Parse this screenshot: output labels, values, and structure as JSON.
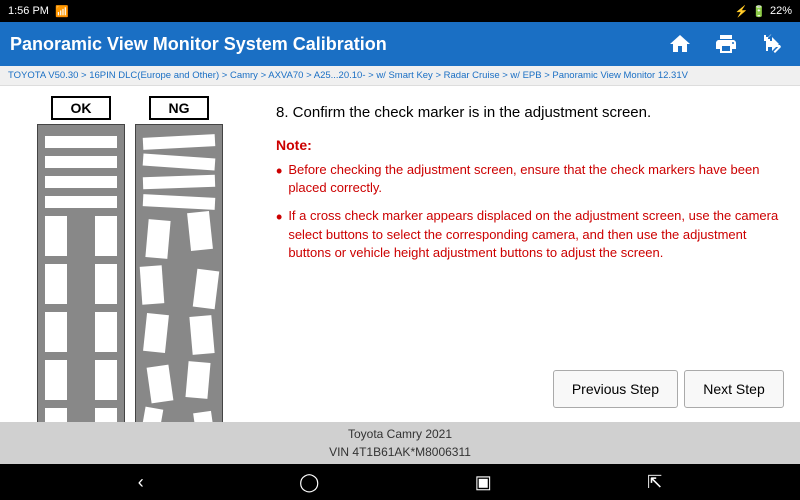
{
  "status_bar": {
    "time": "1:56 PM",
    "battery": "22%"
  },
  "header": {
    "title": "Panoramic View Monitor System Calibration",
    "home_icon": "🏠",
    "print_icon": "🖨",
    "share_icon": "⬆"
  },
  "breadcrumb": {
    "text": "TOYOTA V50.30 > 16PIN DLC(Europe and Other) > Camry > AXVA70 > A25...20.10- > w/ Smart Key > Radar Cruise > w/ EPB > Panoramic View Monitor   12.31V"
  },
  "left_panel": {
    "ok_label": "OK",
    "ng_label": "NG"
  },
  "right_panel": {
    "step_title": "8. Confirm the check marker is in the adjustment screen.",
    "note_label": "Note:",
    "bullets": [
      "Before checking the adjustment screen, ensure that the check markers have been placed correctly.",
      "If a cross check marker appears displaced on the adjustment screen, use the camera select buttons to select the corresponding camera, and then use the adjustment buttons or vehicle height adjustment buttons to adjust the screen."
    ]
  },
  "buttons": {
    "previous": "Previous Step",
    "next": "Next Step"
  },
  "footer": {
    "line1": "Toyota Camry 2021",
    "line2": "VIN 4T1B61AK*M8006311"
  }
}
